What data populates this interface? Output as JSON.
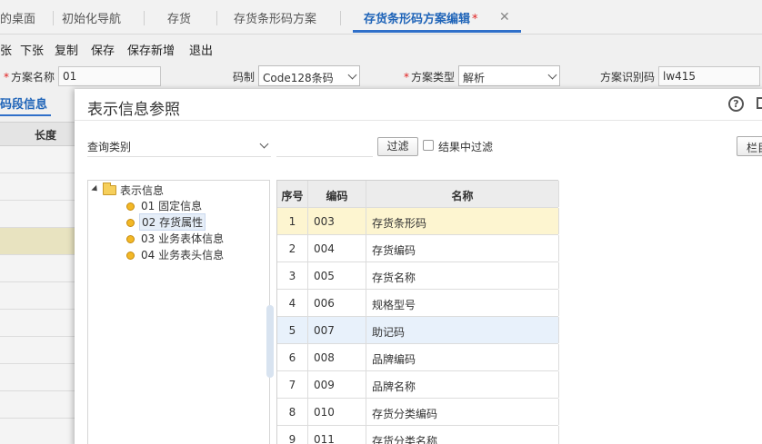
{
  "tabs": [
    {
      "label": "的桌面"
    },
    {
      "label": "初始化导航"
    },
    {
      "label": "存货"
    },
    {
      "label": "存货条形码方案"
    },
    {
      "label": "存货条形码方案编辑",
      "modified_marker": "*"
    }
  ],
  "toolbar": [
    "张",
    "下张",
    "复制",
    "保存",
    "保存新增",
    "退出"
  ],
  "form": {
    "name_label": "方案名称",
    "name_value": "01",
    "code_label": "码制",
    "code_value": "Code128条码",
    "type_label": "方案类型",
    "type_value": "解析",
    "id_label": "方案识别码",
    "id_value": "lw415"
  },
  "background": {
    "subtab": "码段信息",
    "column_header": "长度"
  },
  "modal": {
    "title": "表示信息参照",
    "query_category": "查询类别",
    "filter_button": "过滤",
    "filter_in_results": "结果中过滤",
    "columns_button": "栏目",
    "tree": {
      "root": "表示信息",
      "items": [
        "01 固定信息",
        "02 存货属性",
        "03 业务表体信息",
        "04 业务表头信息"
      ]
    },
    "grid": {
      "headers": [
        "序号",
        "编码",
        "名称"
      ],
      "rows": [
        {
          "idx": "1",
          "code": "003",
          "name": "存货条形码"
        },
        {
          "idx": "2",
          "code": "004",
          "name": "存货编码"
        },
        {
          "idx": "3",
          "code": "005",
          "name": "存货名称"
        },
        {
          "idx": "4",
          "code": "006",
          "name": "规格型号"
        },
        {
          "idx": "5",
          "code": "007",
          "name": "助记码"
        },
        {
          "idx": "6",
          "code": "008",
          "name": "品牌编码"
        },
        {
          "idx": "7",
          "code": "009",
          "name": "品牌名称"
        },
        {
          "idx": "8",
          "code": "010",
          "name": "存货分类编码"
        },
        {
          "idx": "9",
          "code": "011",
          "name": "存货分类名称"
        }
      ]
    }
  },
  "colors": {
    "accent": "#2f6fc9",
    "required": "#e02020",
    "row_selected": "#fdf5d0",
    "row_hover": "#e8f1fb"
  }
}
